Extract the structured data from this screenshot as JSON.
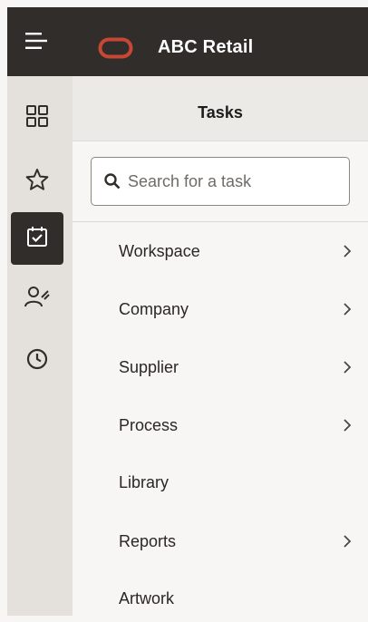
{
  "header": {
    "menu_icon": "hamburger-menu-icon",
    "logo_icon": "oracle-logo-icon",
    "brand_name": "ABC Retail",
    "brand_color": "#c74634",
    "background": "#312d2a"
  },
  "rail": {
    "items": [
      {
        "icon": "grid-icon",
        "label": "dashboard",
        "active": false
      },
      {
        "icon": "star-icon",
        "label": "favorites",
        "active": false
      },
      {
        "icon": "calendar-check-icon",
        "label": "tasks",
        "active": true
      },
      {
        "icon": "people-icon",
        "label": "contacts",
        "active": false
      },
      {
        "icon": "clock-icon",
        "label": "recent",
        "active": false
      }
    ]
  },
  "panel": {
    "title": "Tasks",
    "search": {
      "placeholder": "Search for a task",
      "value": ""
    },
    "items": [
      {
        "label": "Workspace",
        "has_submenu": true
      },
      {
        "label": "Company",
        "has_submenu": true
      },
      {
        "label": "Supplier",
        "has_submenu": true
      },
      {
        "label": "Process",
        "has_submenu": true
      },
      {
        "label": "Library",
        "has_submenu": false
      },
      {
        "label": "Reports",
        "has_submenu": true
      },
      {
        "label": "Artwork",
        "has_submenu": false
      }
    ]
  }
}
